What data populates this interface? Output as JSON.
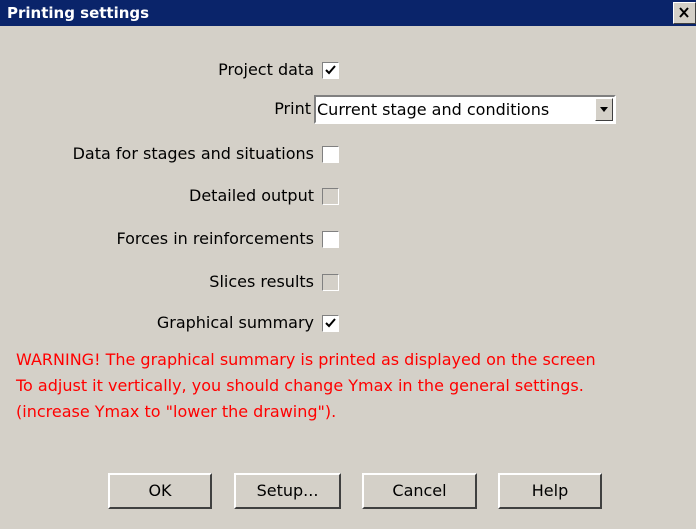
{
  "window": {
    "title": "Printing settings"
  },
  "options": {
    "project_data": {
      "label": "Project data",
      "checked": true,
      "enabled": true
    },
    "print": {
      "label": "Print",
      "selected": "Current stage and conditions"
    },
    "data_stages": {
      "label": "Data for stages and situations",
      "checked": false,
      "enabled": true
    },
    "detailed_output": {
      "label": "Detailed output",
      "checked": false,
      "enabled": false
    },
    "forces_reinforcements": {
      "label": "Forces in reinforcements",
      "checked": false,
      "enabled": true
    },
    "slices_results": {
      "label": "Slices results",
      "checked": false,
      "enabled": false
    },
    "graphical_summary": {
      "label": "Graphical summary",
      "checked": true,
      "enabled": true
    }
  },
  "warning": {
    "line1": "WARNING! The graphical summary is printed as displayed on the screen",
    "line2": "To adjust it vertically, you should change Ymax in the general settings.",
    "line3": "(increase Ymax to \"lower the drawing\")."
  },
  "buttons": {
    "ok": "OK",
    "setup": "Setup...",
    "cancel": "Cancel",
    "help": "Help"
  },
  "colors": {
    "titlebar": "#0a246a",
    "background": "#d4d0c8",
    "warning": "#ff0000"
  }
}
